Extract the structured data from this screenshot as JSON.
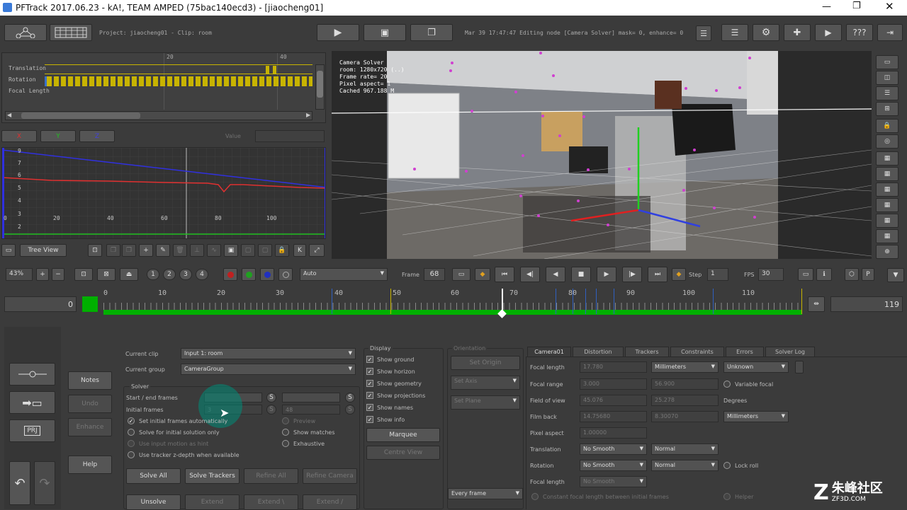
{
  "window": {
    "title": "PFTrack 2017.06.23 - kA!, TEAM AMPED (75bac140ecd3) - [jiaocheng01]"
  },
  "toolbar": {
    "project": "Project: jiaocheng01 - Clip: room",
    "status": "Mar 39 17:47:47 Editing node [Camera Solver] mask= 0, enhance= 0",
    "help_label": "???"
  },
  "curve_top": {
    "tick20": "20",
    "tick40": "40",
    "rows": [
      "Translation",
      "Rotation",
      "Focal Length"
    ]
  },
  "axes": {
    "x": "X",
    "y": "Y",
    "z": "Z",
    "value_label": "Value"
  },
  "graph": {
    "y_ticks": [
      "9",
      "7",
      "6",
      "5",
      "4",
      "3",
      "2"
    ],
    "x_ticks": [
      "0",
      "20",
      "40",
      "60",
      "80",
      "100"
    ]
  },
  "graph_bar": {
    "tree_view": "Tree View"
  },
  "viewport": {
    "info": [
      "Camera Solver",
      "room: 1280x720 (..)",
      "Frame rate= 20",
      "Pixel aspect= 1",
      "Cached 967.188 M"
    ]
  },
  "viewport_bar": {
    "zoom": "43%",
    "presets": [
      "1",
      "2",
      "3",
      "4"
    ],
    "mode": "Auto",
    "frame_label": "Frame",
    "frame": "68",
    "step_label": "Step",
    "step": "1",
    "fps_label": "FPS",
    "fps": "30"
  },
  "timeline": {
    "start": "0",
    "end": "119",
    "ticks": [
      "0",
      "10",
      "20",
      "30",
      "40",
      "50",
      "60",
      "70",
      "80",
      "90",
      "100",
      "110"
    ]
  },
  "left_buttons": {
    "notes": "Notes",
    "undo": "Undo",
    "enhance": "Enhance",
    "help": "Help"
  },
  "clip": {
    "current_clip_label": "Current clip",
    "current_clip": "Input 1: room",
    "current_group_label": "Current group",
    "current_group": "CameraGroup"
  },
  "solver": {
    "title": "Solver",
    "start_end_label": "Start / end frames",
    "initial_label": "Initial frames",
    "initial_a": "3",
    "initial_b": "48",
    "s": "S",
    "opt_set_initial": "Set initial frames automatically",
    "opt_solve_initial": "Solve for initial solution only",
    "opt_input_motion": "Use input motion as hint",
    "opt_zdepth": "Use tracker z-depth when available",
    "opt_preview": "Preview",
    "opt_show_matches": "Show matches",
    "opt_exhaustive": "Exhaustive",
    "solve_all": "Solve All",
    "solve_trackers": "Solve Trackers",
    "refine_all": "Refine All",
    "refine_camera": "Refine Camera",
    "unsolve": "Unsolve",
    "extend": "Extend",
    "extend_a": "Extend \\",
    "extend_b": "Extend /"
  },
  "display": {
    "title": "Display",
    "items": [
      "Show ground",
      "Show horizon",
      "Show geometry",
      "Show projections",
      "Show names",
      "Show info"
    ],
    "marquee": "Marquee",
    "centre_view": "Centre View"
  },
  "orientation": {
    "title": "Orientation",
    "set_origin": "Set Origin",
    "set_axis": "Set Axis",
    "set_plane": "Set Plane",
    "every_frame": "Every frame"
  },
  "tabs": [
    "Camera01",
    "Distortion",
    "Trackers",
    "Constraints",
    "Errors",
    "Solver Log"
  ],
  "camera": {
    "focal_length_label": "Focal length",
    "focal_length": "17.780",
    "focal_units": "Millimeters",
    "focal_mode": "Unknown",
    "focal_range_label": "Focal range",
    "focal_range_a": "3.000",
    "focal_range_b": "56.900",
    "variable_focal": "Variable focal",
    "fov_label": "Field of view",
    "fov_a": "45.076",
    "fov_b": "25.278",
    "degrees": "Degrees",
    "film_back_label": "Film back",
    "film_back_a": "14.75680",
    "film_back_b": "8.30070",
    "film_units": "Millimeters",
    "pixel_aspect_label": "Pixel aspect",
    "pixel_aspect": "1.00000",
    "translation_label": "Translation",
    "rotation_label": "Rotation",
    "focal_length2_label": "Focal length",
    "no_smooth": "No Smooth",
    "normal": "Normal",
    "lock_roll": "Lock roll",
    "constant_focal": "Constant focal length between initial frames",
    "helper": "Helper"
  },
  "watermark": {
    "cn": "朱峰社区",
    "url": "ZF3D.COM"
  },
  "colors": {
    "accent": "#00b000",
    "curve_red": "#e03030",
    "curve_blue": "#3030e0",
    "curve_green": "#20c020",
    "key_yellow": "#c8b400"
  }
}
